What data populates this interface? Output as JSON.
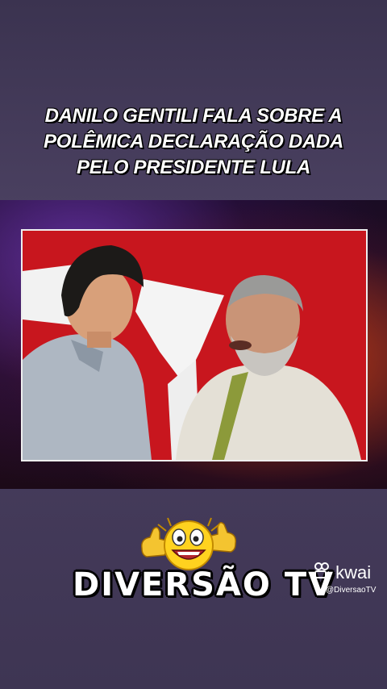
{
  "headline": {
    "line1": "DANILO GENTILI FALA SOBRE A",
    "line2": "POLÊMICA DECLARAÇÃO DADA",
    "line3": "PELO PRESIDENTE LULA"
  },
  "brand": {
    "name": "DIVERSÃO TV",
    "emoji": "thumbs-up-laughing-emoji"
  },
  "watermark": {
    "platform": "kwai",
    "handle": "@DiversaoTV",
    "icon": "kwai-logo-icon"
  },
  "colors": {
    "background": "#463c5c",
    "video_backdrop": "#c4141c",
    "accent_glow": "#ff8c28"
  }
}
